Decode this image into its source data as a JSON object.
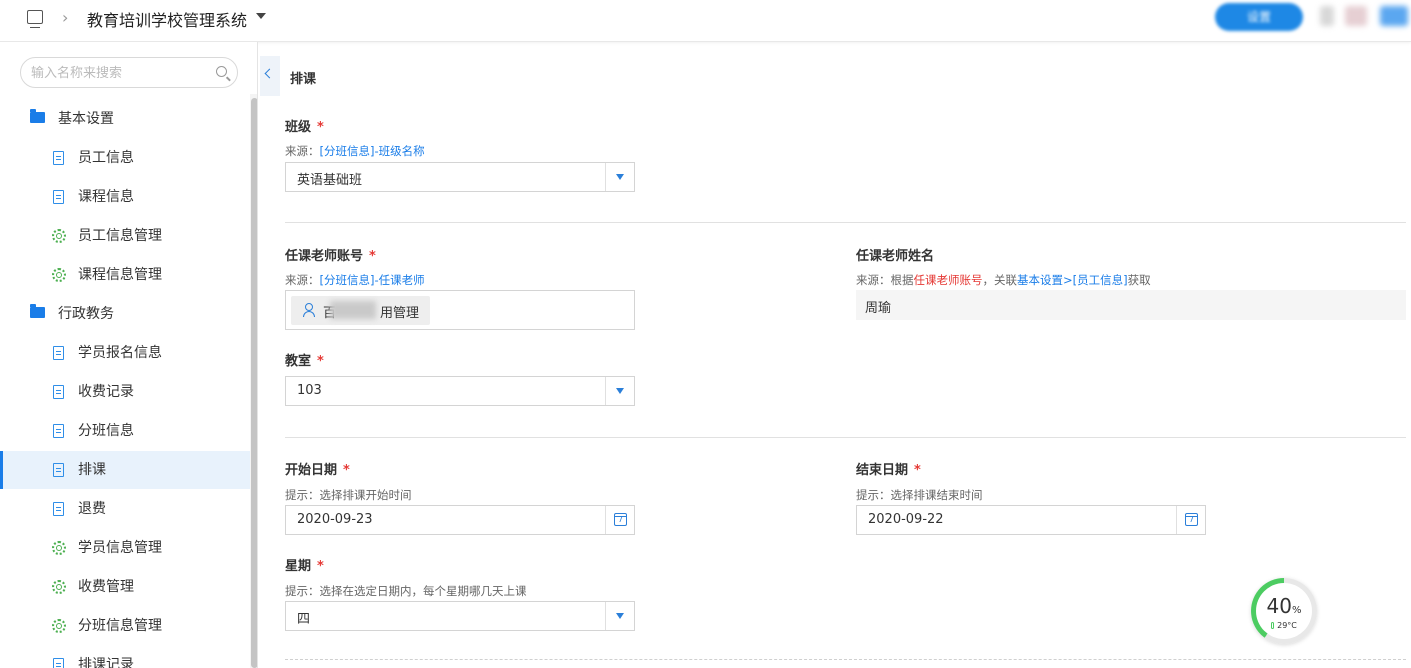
{
  "header": {
    "app_title": "教育培训学校管理系统",
    "top_button_label": "设置"
  },
  "sidebar": {
    "search_placeholder": "输入名称来搜索",
    "items": [
      {
        "label": "基本设置",
        "type": "group",
        "icon": "folder-icon"
      },
      {
        "label": "员工信息",
        "type": "child",
        "icon": "document-icon"
      },
      {
        "label": "课程信息",
        "type": "child",
        "icon": "document-icon"
      },
      {
        "label": "员工信息管理",
        "type": "child",
        "icon": "gear-icon"
      },
      {
        "label": "课程信息管理",
        "type": "child",
        "icon": "gear-icon"
      },
      {
        "label": "行政教务",
        "type": "group",
        "icon": "folder-icon"
      },
      {
        "label": "学员报名信息",
        "type": "child",
        "icon": "document-icon"
      },
      {
        "label": "收费记录",
        "type": "child",
        "icon": "document-icon"
      },
      {
        "label": "分班信息",
        "type": "child",
        "icon": "document-icon"
      },
      {
        "label": "排课",
        "type": "child",
        "icon": "document-icon",
        "active": true
      },
      {
        "label": "退费",
        "type": "child",
        "icon": "document-icon"
      },
      {
        "label": "学员信息管理",
        "type": "child",
        "icon": "gear-icon"
      },
      {
        "label": "收费管理",
        "type": "child",
        "icon": "gear-icon"
      },
      {
        "label": "分班信息管理",
        "type": "child",
        "icon": "gear-icon"
      },
      {
        "label": "排课记录",
        "type": "child",
        "icon": "document-icon"
      }
    ]
  },
  "form": {
    "title": "排课",
    "class": {
      "label": "班级",
      "hint_prefix": "来源：",
      "hint_link": "[分班信息]-班级名称",
      "value": "英语基础班"
    },
    "teacher_account": {
      "label": "任课老师账号",
      "hint_prefix": "来源：",
      "hint_link": "[分班信息]-任课老师",
      "value": "用管理"
    },
    "teacher_name": {
      "label": "任课老师姓名",
      "hint_prefix": "来源：根据",
      "hint_red": "任课老师账号",
      "hint_mid": "，关联",
      "hint_link": "基本设置>[员工信息]",
      "hint_suffix": "获取",
      "value": "周瑜"
    },
    "classroom": {
      "label": "教室",
      "value": "103"
    },
    "start_date": {
      "label": "开始日期",
      "hint": "提示：选择排课开始时间",
      "value": "2020-09-23"
    },
    "end_date": {
      "label": "结束日期",
      "hint": "提示：选择排课结束时间",
      "value": "2020-09-22"
    },
    "weekday": {
      "label": "星期",
      "hint": "提示：选择在选定日期内，每个星期哪几天上课",
      "value": "四"
    },
    "required_mark": "*"
  },
  "widget": {
    "percent": "40",
    "percent_unit": "%",
    "percent_value": 40,
    "temperature": "29°C"
  },
  "colors": {
    "accent": "#1a7de8",
    "required": "#e53935",
    "gauge": "#4ccc61"
  }
}
